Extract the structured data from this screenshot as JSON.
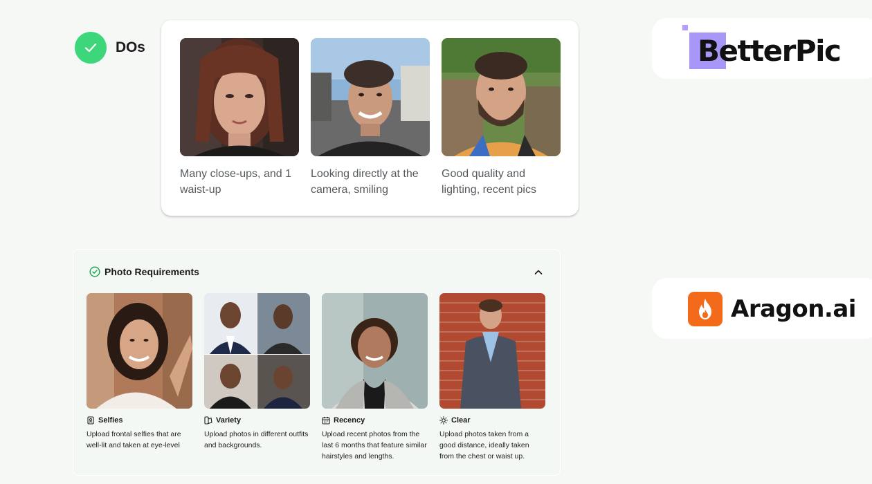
{
  "dos": {
    "label": "DOs",
    "items": [
      {
        "caption": "Many close-ups, and 1 waist-up"
      },
      {
        "caption": "Looking directly at the camera, smiling"
      },
      {
        "caption": "Good quality and lighting, recent pics"
      }
    ]
  },
  "requirements": {
    "title": "Photo Requirements",
    "items": [
      {
        "icon": "selfie-icon",
        "label": "Selfies",
        "description": "Upload frontal selfies that are well-lit and taken at eye-level"
      },
      {
        "icon": "variety-icon",
        "label": "Variety",
        "description": "Upload photos in different outfits and backgrounds."
      },
      {
        "icon": "calendar-icon",
        "label": "Recency",
        "description": "Upload recent photos from the last 6 months that feature similar hairstyles and lengths."
      },
      {
        "icon": "sun-icon",
        "label": "Clear",
        "description": "Upload photos taken from a good distance, ideally taken from the chest or waist up."
      }
    ]
  },
  "brands": {
    "betterpic": "BetterPic",
    "aragon": "Aragon.ai"
  },
  "colors": {
    "check_green": "#3dd67b",
    "betterpic_purple": "#a897f6",
    "aragon_orange": "#f26a1a"
  }
}
